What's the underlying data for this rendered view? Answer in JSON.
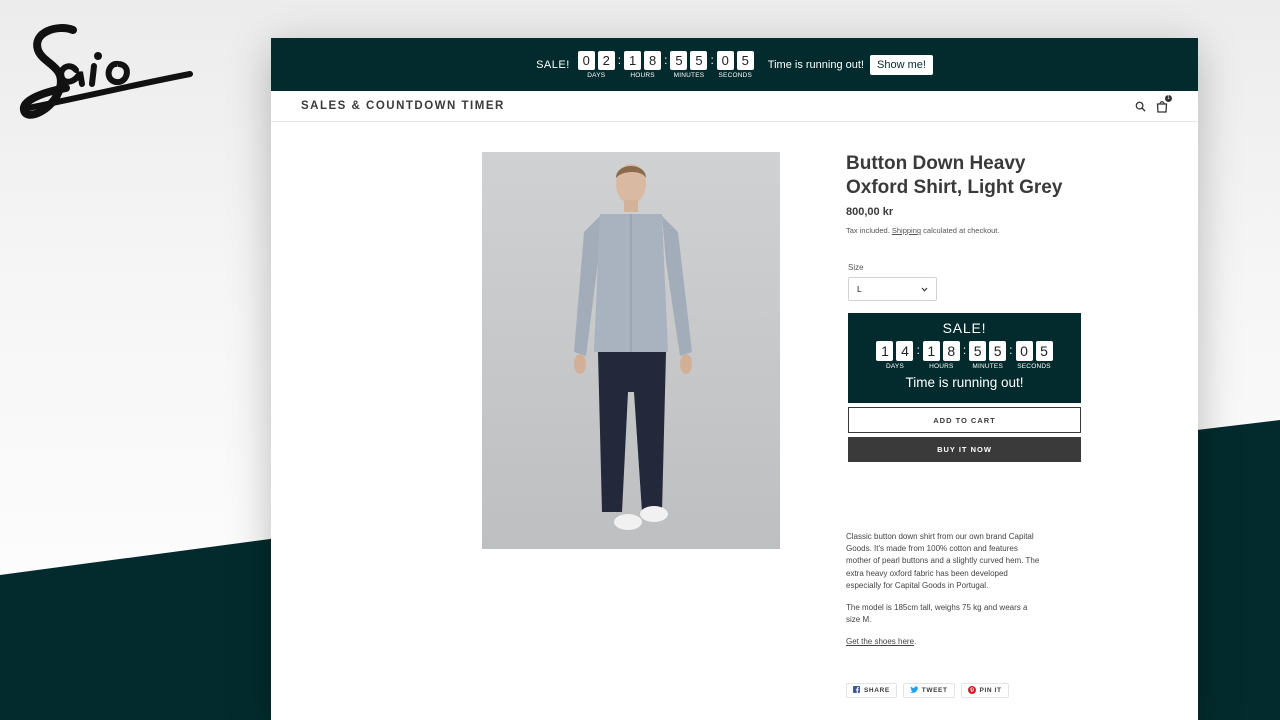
{
  "brand_logo_text": "Saio",
  "colors": {
    "accent": "#032b2d",
    "button_dark": "#3a3a3a"
  },
  "announcement": {
    "sale_label": "SALE!",
    "digits": {
      "days": [
        "0",
        "2"
      ],
      "hours": [
        "1",
        "8"
      ],
      "minutes": [
        "5",
        "5"
      ],
      "seconds": [
        "0",
        "5"
      ]
    },
    "labels": {
      "days": "DAYS",
      "hours": "HOURS",
      "minutes": "MINUTES",
      "seconds": "SECONDS"
    },
    "message": "Time is running out!",
    "button_label": "Show me!"
  },
  "header": {
    "store_name": "SALES & COUNTDOWN TIMER",
    "search_icon": "search-icon",
    "cart_icon": "cart-icon",
    "cart_count": "1"
  },
  "product": {
    "image_alt": "Model wearing light grey oxford shirt",
    "title": "Button Down Heavy Oxford Shirt, Light Grey",
    "price": "800,00 kr",
    "tax_text_before": "Tax included.",
    "tax_link": "Shipping",
    "tax_text_after": "calculated at checkout.",
    "size_label": "Size",
    "size_value": "L",
    "timer": {
      "sale_label": "SALE!",
      "digits": {
        "days": [
          "1",
          "4"
        ],
        "hours": [
          "1",
          "8"
        ],
        "minutes": [
          "5",
          "5"
        ],
        "seconds": [
          "0",
          "5"
        ]
      },
      "labels": {
        "days": "DAYS",
        "hours": "HOURS",
        "minutes": "MINUTES",
        "seconds": "SECONDS"
      },
      "message": "Time is running out!"
    },
    "add_to_cart_label": "ADD TO CART",
    "buy_now_label": "BUY IT NOW",
    "description_1": "Classic button down shirt from our own brand Capital Goods. It's made from 100% cotton and features mother of pearl buttons and a slightly curved hem. The extra heavy oxford fabric has been developed especially for Capital Goods in Portugal.",
    "description_2": "The model is 185cm tall, weighs 75 kg and wears a size M.",
    "shoes_link": "Get the shoes here",
    "shoes_link_suffix": "."
  },
  "share": [
    {
      "label": "SHARE",
      "icon": "facebook-icon"
    },
    {
      "label": "TWEET",
      "icon": "twitter-icon"
    },
    {
      "label": "PIN IT",
      "icon": "pinterest-icon"
    }
  ]
}
